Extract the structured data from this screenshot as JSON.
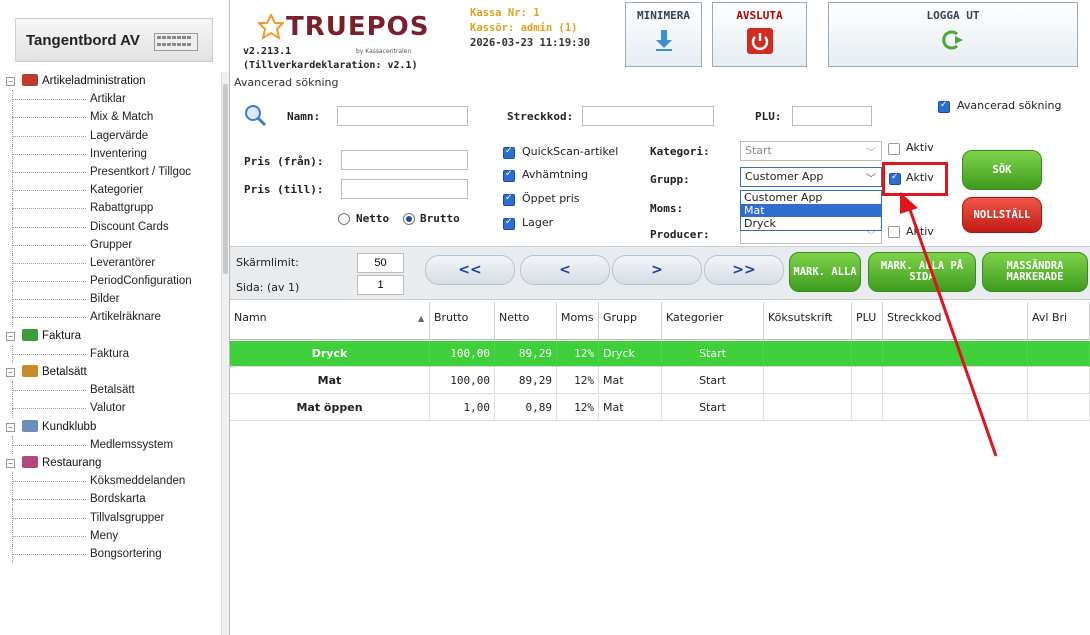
{
  "keyboard": {
    "label": "Tangentbord AV"
  },
  "tree": [
    {
      "type": "group",
      "label": "Artikeladministration",
      "color": "#c0392b",
      "children": [
        "Artiklar",
        "Mix & Match",
        "Lagervärde",
        "Inventering",
        "Presentkort / Tillgoc",
        "Kategorier",
        "Rabattgrupp",
        "Discount Cards",
        "Grupper",
        "Leverantörer",
        "PeriodConfiguration",
        "Bilder",
        "Artikelräknare"
      ]
    },
    {
      "type": "group",
      "label": "Faktura",
      "color": "#3d9b3a",
      "children": [
        "Faktura"
      ]
    },
    {
      "type": "group",
      "label": "Betalsätt",
      "color": "#c98b2a",
      "children": [
        "Betalsätt",
        "Valutor"
      ]
    },
    {
      "type": "group",
      "label": "Kundklubb",
      "color": "#6a8fb8",
      "children": [
        "Medlemssystem"
      ]
    },
    {
      "type": "group",
      "label": "Restaurang",
      "color": "#b04a7a",
      "children": [
        "Köksmeddelanden",
        "Bordskarta",
        "Tillvalsgrupper",
        "Meny",
        "Bongsortering"
      ]
    }
  ],
  "header": {
    "logo_text": "TRUEPOS",
    "version": "v2.213.1",
    "vendor": "by Kassacentralen",
    "declaration": "(Tillverkardeklaration: v2.1)",
    "kassa": "Kassa Nr: 1",
    "cashier": "Kassör: admin (1)",
    "datetime": "2026-03-23 11:19:30",
    "minimize": "MINIMERA",
    "exit": "AVSLUTA",
    "logout": "LOGGA UT",
    "section_title": "Avancerad sökning"
  },
  "search": {
    "name_label": "Namn:",
    "name_value": "",
    "barcode_label": "Streckkod:",
    "barcode_value": "",
    "plu_label": "PLU:",
    "plu_value": "",
    "advanced_label": "Avancerad sökning",
    "advanced_checked": true,
    "price_from_label": "Pris (från):",
    "price_to_label": "Pris (till):",
    "netto_label": "Netto",
    "brutto_label": "Brutto",
    "quickscan_label": "QuickScan-artikel",
    "pickup_label": "Avhämtning",
    "open_price_label": "Öppet pris",
    "stock_label": "Lager",
    "category_label": "Kategori:",
    "category_value": "Start",
    "group_label": "Grupp:",
    "group_value": "Customer App",
    "group_options": [
      "Customer App",
      "Mat",
      "Dryck"
    ],
    "group_highlighted": "Mat",
    "vat_label": "Moms:",
    "producer_label": "Producer:",
    "active_label": "Aktiv",
    "search_button": "SÖK",
    "reset_button": "NOLLSTÄLL"
  },
  "paging": {
    "screen_limit_label": "Skärmlimit:",
    "screen_limit_value": "50",
    "page_label": "Sida: (av 1)",
    "page_value": "1",
    "first": "<<",
    "prev": "<",
    "next": ">",
    "last": ">>",
    "mark_all": "MARK. ALLA",
    "mark_all_page": "MARK. ALLA PÅ SIDA",
    "mass_send": "MASSÄNDRA MARKERADE"
  },
  "table": {
    "headers": [
      "Namn",
      "Brutto",
      "Netto",
      "Moms",
      "Grupp",
      "Kategorier",
      "Köksutskrift",
      "PLU",
      "Streckkod",
      "Avl Bri"
    ],
    "rows": [
      {
        "name": "Dryck",
        "brutto": "100,00",
        "netto": "89,29",
        "moms": "12%",
        "group": "Dryck",
        "category": "Start",
        "selected": true
      },
      {
        "name": "Mat",
        "brutto": "100,00",
        "netto": "89,29",
        "moms": "12%",
        "group": "Mat",
        "category": "Start",
        "selected": false
      },
      {
        "name": "Mat öppen",
        "brutto": "1,00",
        "netto": "0,89",
        "moms": "12%",
        "group": "Mat",
        "category": "Start",
        "selected": false
      }
    ]
  },
  "colors": {
    "accent": "#2f6dd3",
    "selected_row": "#3fcf3a",
    "annotation": "#e0141e"
  }
}
